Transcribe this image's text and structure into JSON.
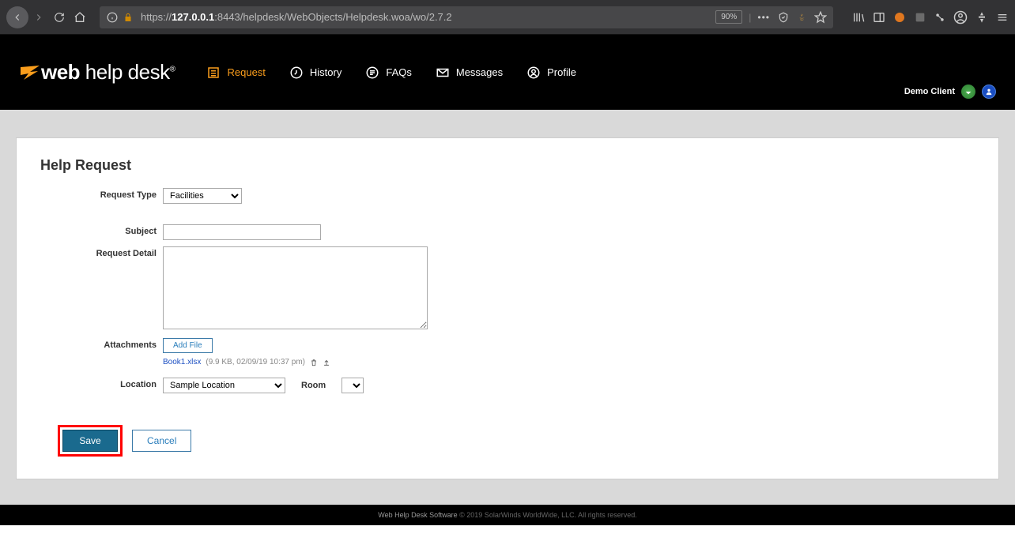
{
  "browser": {
    "url_prefix": "https://",
    "url_host": "127.0.0.1",
    "url_rest": ":8443/helpdesk/WebObjects/Helpdesk.woa/wo/2.7.2",
    "zoom": "90%"
  },
  "header": {
    "logo_bold": "web",
    "logo_rest": " help desk",
    "nav": [
      {
        "label": "Request",
        "icon": "list-icon",
        "active": true
      },
      {
        "label": "History",
        "icon": "clock-icon",
        "active": false
      },
      {
        "label": "FAQs",
        "icon": "faq-icon",
        "active": false
      },
      {
        "label": "Messages",
        "icon": "mail-icon",
        "active": false
      },
      {
        "label": "Profile",
        "icon": "profile-icon",
        "active": false
      }
    ],
    "user_name": "Demo Client"
  },
  "form": {
    "title": "Help Request",
    "labels": {
      "request_type": "Request Type",
      "subject": "Subject",
      "request_detail": "Request Detail",
      "attachments": "Attachments",
      "location": "Location",
      "room": "Room"
    },
    "request_type_value": "Facilities",
    "subject_value": "",
    "detail_value": "",
    "add_file_label": "Add File",
    "attachment": {
      "name": "Book1.xlsx",
      "meta": "(9.9 KB, 02/09/19 10:37 pm)"
    },
    "location_value": "Sample Location",
    "room_value": "",
    "buttons": {
      "save": "Save",
      "cancel": "Cancel"
    }
  },
  "footer": {
    "link": "Web Help Desk Software",
    "rest": " © 2019 SolarWinds WorldWide, LLC. All rights reserved."
  }
}
